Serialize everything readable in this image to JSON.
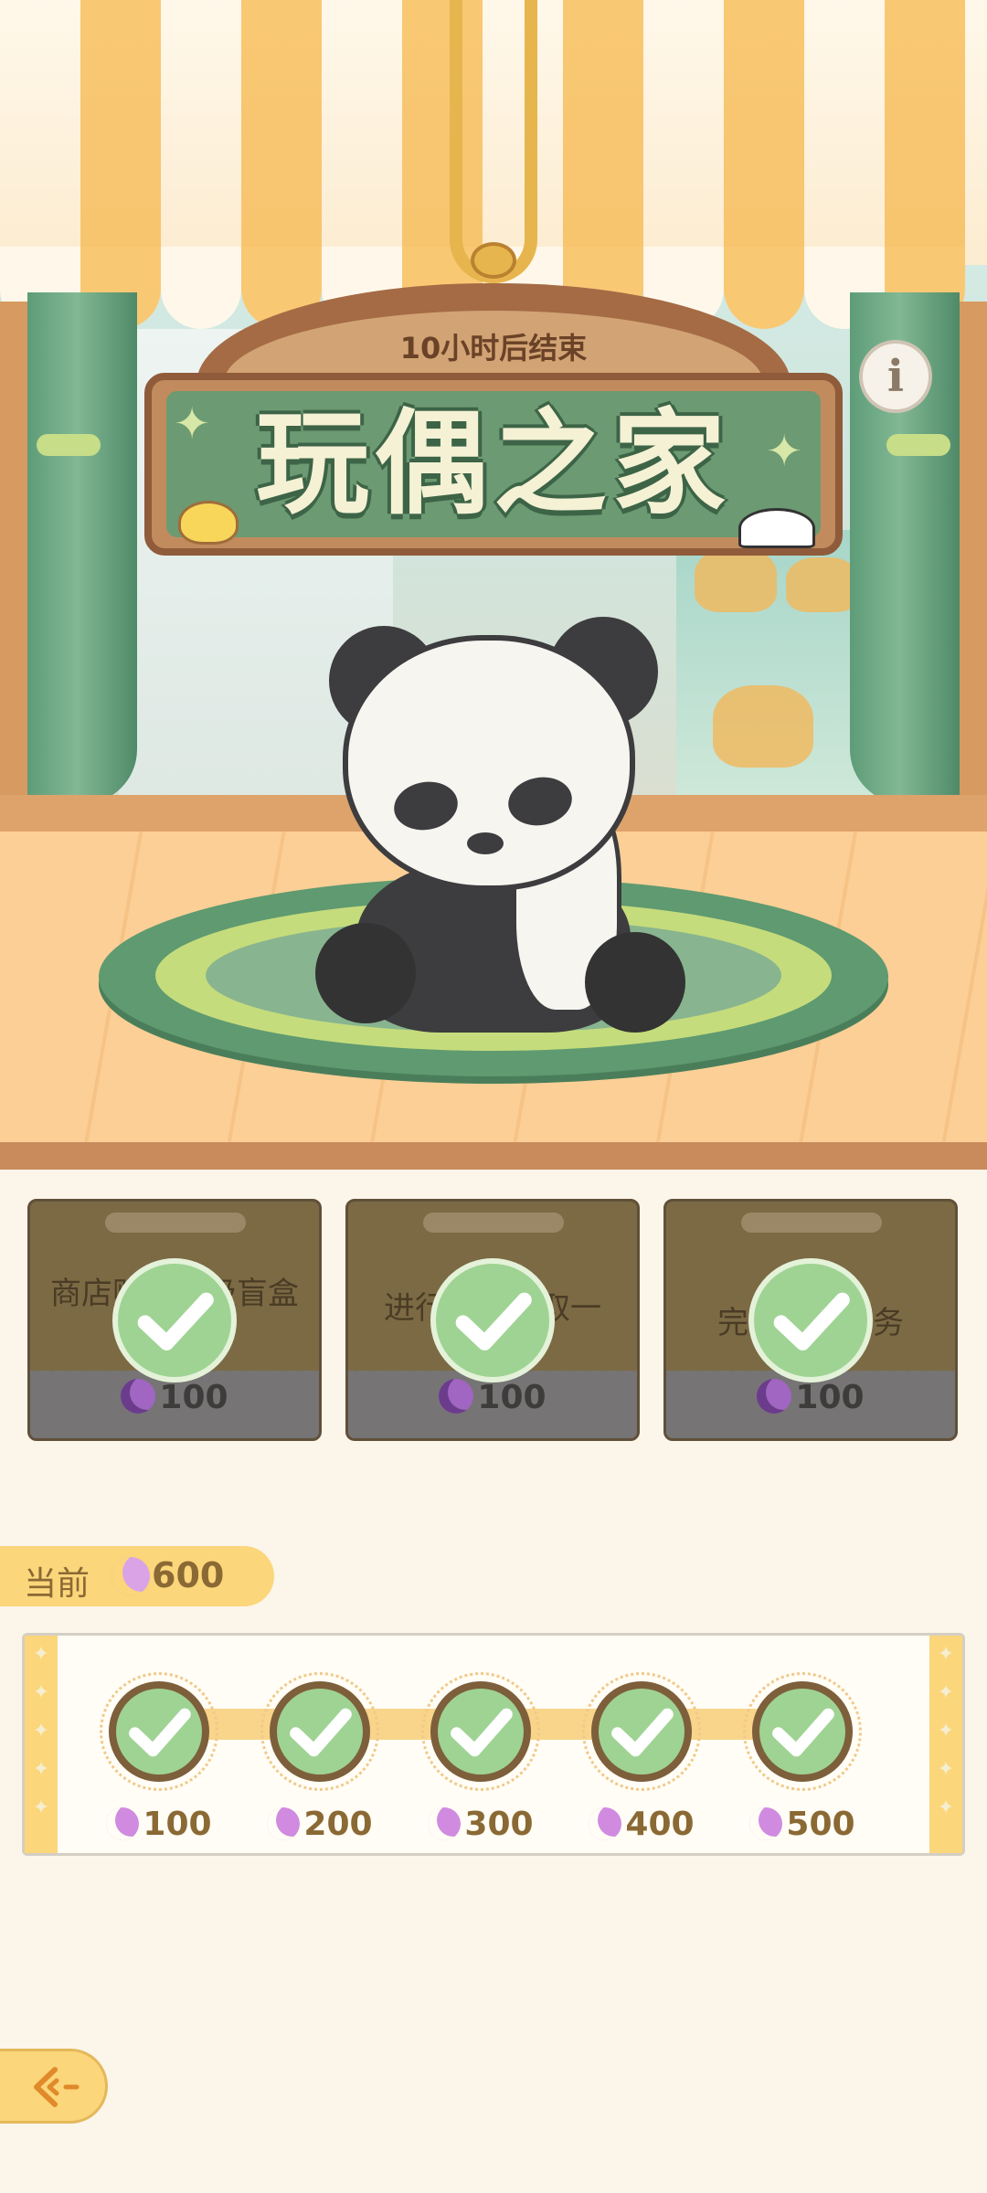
{
  "event": {
    "timer": "10小时后结束",
    "title": "玩偶之家"
  },
  "tasks": [
    {
      "text": "商店购买高级盲盒",
      "reward": "100",
      "completed": true
    },
    {
      "text": "进行扭蛋领取一",
      "reward": "100",
      "completed": true
    },
    {
      "text": "完成每日任务",
      "reward": "100",
      "completed": true
    }
  ],
  "current": {
    "label": "当前",
    "value": "600"
  },
  "milestones": [
    {
      "value": "100",
      "completed": true
    },
    {
      "value": "200",
      "completed": true
    },
    {
      "value": "300",
      "completed": true
    },
    {
      "value": "400",
      "completed": true
    },
    {
      "value": "500",
      "completed": true
    }
  ],
  "icons": {
    "info": "info-icon",
    "moon": "moon-icon",
    "check": "check-icon",
    "back": "back-icon"
  },
  "colors": {
    "accent": "#fbd67a",
    "check_green": "#9fd393",
    "sign_green": "#6c9a72"
  }
}
